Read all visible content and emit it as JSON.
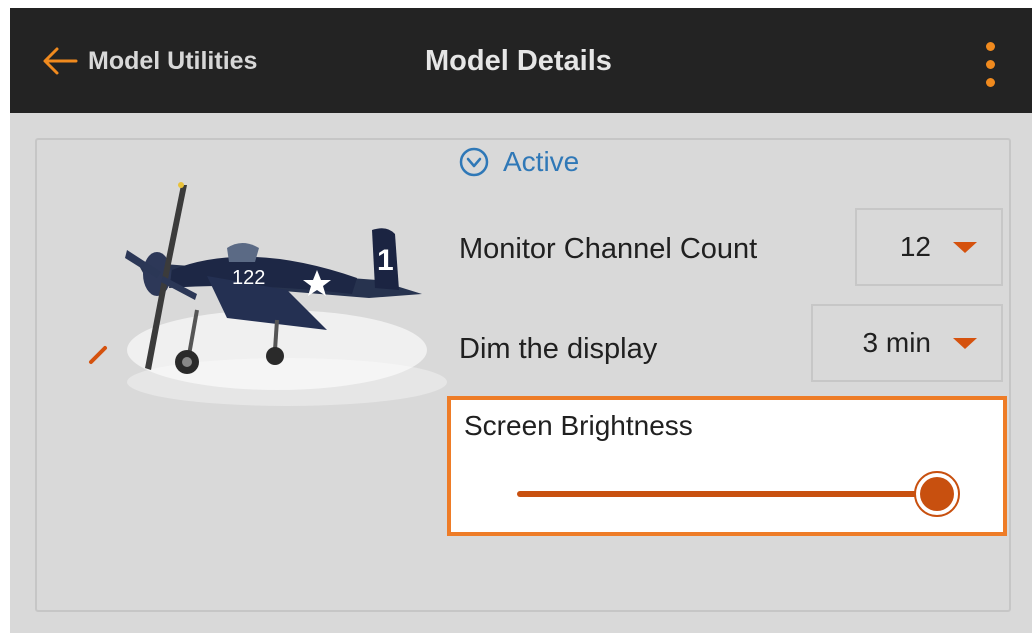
{
  "header": {
    "back_label": "Model Utilities",
    "title": "Model Details",
    "accent": "#f08a1e"
  },
  "icons": {
    "back": "arrow-left-icon",
    "menu": "more-vertical-icon",
    "collapse": "chevron-down-circle-icon"
  },
  "panel": {
    "status_label": "Active",
    "monitor_channel_count": {
      "label": "Monitor Channel Count",
      "value": "12"
    },
    "dim_display": {
      "label": "Dim the display",
      "value": "3 min"
    },
    "screen_brightness": {
      "label": "Screen Brightness",
      "level_percent": 100
    }
  },
  "colors": {
    "highlight": "#ee7c27",
    "slider": "#c8500f",
    "link": "#2f78b7"
  }
}
